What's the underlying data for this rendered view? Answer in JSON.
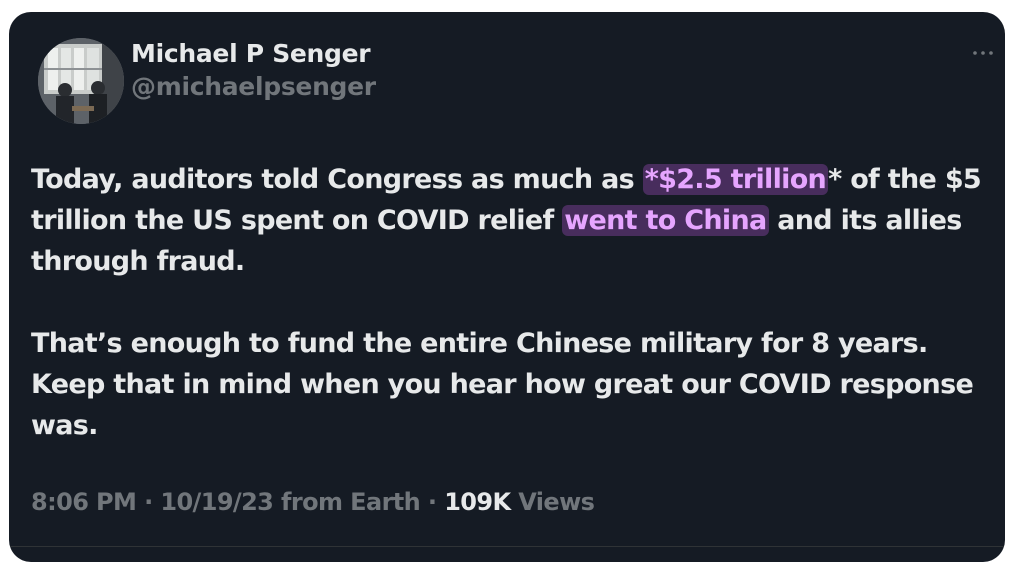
{
  "author": {
    "display_name": "Michael P Senger",
    "handle": "@michaelpsenger"
  },
  "tweet": {
    "p1": {
      "t1": "Today, auditors told Congress as much as ",
      "h1": "*$2.5 trillion",
      "t2": "* of the $5 trillion the US spent on COVID relief ",
      "h2": "went to China",
      "t3": " and its allies through fraud."
    },
    "p2": "That’s enough to fund the entire Chinese military for 8 years. Keep that in mind when you hear how great our COVID response was."
  },
  "meta": {
    "time": "8:06 PM",
    "sep1": " · ",
    "date": "10/19/23",
    "source": " from Earth",
    "sep2": " · ",
    "views_count": "109K",
    "views_label": " Views"
  },
  "icons": {
    "more": "more-horizontal-icon"
  },
  "colors": {
    "card_background": "#151b24",
    "text_primary": "#e7e9ea",
    "text_secondary": "#71767b",
    "highlight_text": "#e6a5ff",
    "highlight_background": "#5a3670"
  }
}
